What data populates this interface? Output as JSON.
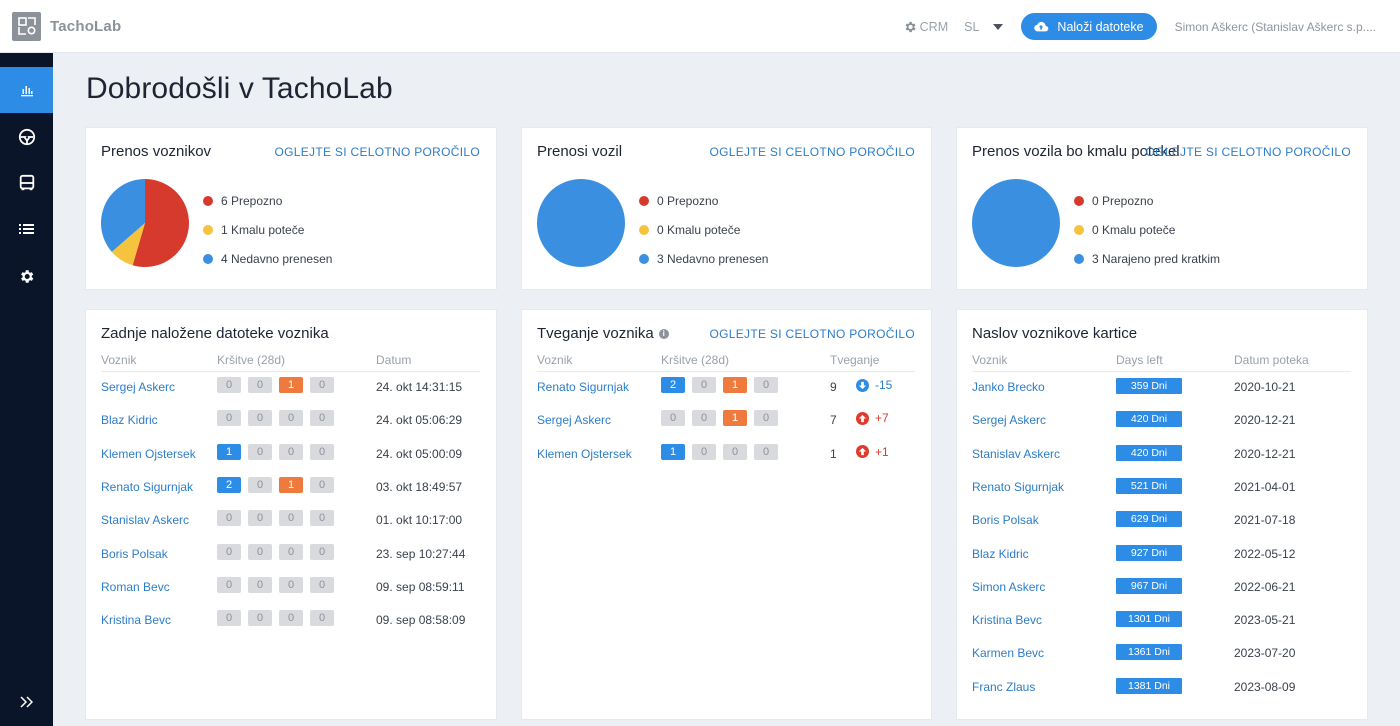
{
  "app": {
    "name": "TachoLab"
  },
  "topbar": {
    "crm_label": "CRM",
    "language": "SL",
    "upload_label": "Naloži datoteke",
    "user": "Simon Aškerc (Stanislav Aškerc s.p...."
  },
  "page": {
    "title": "Dobrodošli v TachoLab"
  },
  "colors": {
    "accent": "#2d8ce6",
    "late": "#d63a2c",
    "soon": "#f5c33e",
    "recent": "#3b8fe0",
    "orange": "#ef7a3e"
  },
  "sidebar": {
    "items": [
      "chart-icon",
      "steering-wheel-icon",
      "bus-icon",
      "list-icon",
      "gear-icon"
    ],
    "active": "chart-icon"
  },
  "cards": {
    "drivers": {
      "title": "Prenos voznikov",
      "link": "OGLEJTE SI CELOTNO POROČILO",
      "legend": [
        {
          "count": 6,
          "label": "6 Prepozno"
        },
        {
          "count": 1,
          "label": "1 Kmalu poteče"
        },
        {
          "count": 4,
          "label": "4 Nedavno prenesen"
        }
      ]
    },
    "vehicles": {
      "title": "Prenosi vozil",
      "link": "OGLEJTE SI CELOTNO POROČILO",
      "legend": [
        {
          "count": 0,
          "label": "0 Prepozno"
        },
        {
          "count": 0,
          "label": "0 Kmalu poteče"
        },
        {
          "count": 3,
          "label": "3 Nedavno prenesen"
        }
      ]
    },
    "vehicles_expiring": {
      "title": "Prenos vozila bo kmalu potekel",
      "link": "OGLEJTE SI CELOTNO POROČILO",
      "legend": [
        {
          "count": 0,
          "label": "0 Prepozno"
        },
        {
          "count": 0,
          "label": "0 Kmalu poteče"
        },
        {
          "count": 3,
          "label": "3 Narajeno pred kratkim"
        }
      ]
    },
    "uploads": {
      "title": "Zadnje naložene datoteke voznika",
      "headers": [
        "Voznik",
        "Kršitve (28d)",
        "Datum"
      ],
      "rows": [
        {
          "driver": "Sergej Askerc",
          "badges": [
            "0",
            "0",
            "1",
            "0"
          ],
          "date": "24. okt 14:31:15"
        },
        {
          "driver": "Blaz Kidric",
          "badges": [
            "0",
            "0",
            "0",
            "0"
          ],
          "date": "24. okt 05:06:29"
        },
        {
          "driver": "Klemen Ojstersek",
          "badges": [
            "1",
            "0",
            "0",
            "0"
          ],
          "date": "24. okt 05:00:09"
        },
        {
          "driver": "Renato Sigurnjak",
          "badges": [
            "2",
            "0",
            "1",
            "0"
          ],
          "date": "03. okt 18:49:57"
        },
        {
          "driver": "Stanislav Askerc",
          "badges": [
            "0",
            "0",
            "0",
            "0"
          ],
          "date": "01. okt 10:17:00"
        },
        {
          "driver": "Boris Polsak",
          "badges": [
            "0",
            "0",
            "0",
            "0"
          ],
          "date": "23. sep 10:27:44"
        },
        {
          "driver": "Roman Bevc",
          "badges": [
            "0",
            "0",
            "0",
            "0"
          ],
          "date": "09. sep 08:59:11"
        },
        {
          "driver": "Kristina Bevc",
          "badges": [
            "0",
            "0",
            "0",
            "0"
          ],
          "date": "09. sep 08:58:09"
        }
      ]
    },
    "risk": {
      "title": "Tveganje voznika",
      "info": "i",
      "link": "OGLEJTE SI CELOTNO POROČILO",
      "headers": [
        "Voznik",
        "Kršitve (28d)",
        "Tveganje"
      ],
      "rows": [
        {
          "driver": "Renato Sigurnjak",
          "badges": [
            "2",
            "0",
            "1",
            "0"
          ],
          "risk": "9",
          "trend": "-15",
          "direction": "down"
        },
        {
          "driver": "Sergej Askerc",
          "badges": [
            "0",
            "0",
            "1",
            "0"
          ],
          "risk": "7",
          "trend": "+7",
          "direction": "up"
        },
        {
          "driver": "Klemen Ojstersek",
          "badges": [
            "1",
            "0",
            "0",
            "0"
          ],
          "risk": "1",
          "trend": "+1",
          "direction": "up"
        }
      ]
    },
    "cards_expiry": {
      "title": "Naslov voznikove kartice",
      "headers": [
        "Voznik",
        "Days left",
        "Datum poteka"
      ],
      "rows": [
        {
          "driver": "Janko Brecko",
          "days": "359 Dni",
          "date": "2020-10-21"
        },
        {
          "driver": "Sergej Askerc",
          "days": "420 Dni",
          "date": "2020-12-21"
        },
        {
          "driver": "Stanislav Askerc",
          "days": "420 Dni",
          "date": "2020-12-21"
        },
        {
          "driver": "Renato Sigurnjak",
          "days": "521 Dni",
          "date": "2021-04-01"
        },
        {
          "driver": "Boris Polsak",
          "days": "629 Dni",
          "date": "2021-07-18"
        },
        {
          "driver": "Blaz Kidric",
          "days": "927 Dni",
          "date": "2022-05-12"
        },
        {
          "driver": "Simon Askerc",
          "days": "967 Dni",
          "date": "2022-06-21"
        },
        {
          "driver": "Kristina Bevc",
          "days": "1301 Dni",
          "date": "2023-05-21"
        },
        {
          "driver": "Karmen Bevc",
          "days": "1361 Dni",
          "date": "2023-07-20"
        },
        {
          "driver": "Franc Zlaus",
          "days": "1381 Dni",
          "date": "2023-08-09"
        }
      ]
    }
  }
}
